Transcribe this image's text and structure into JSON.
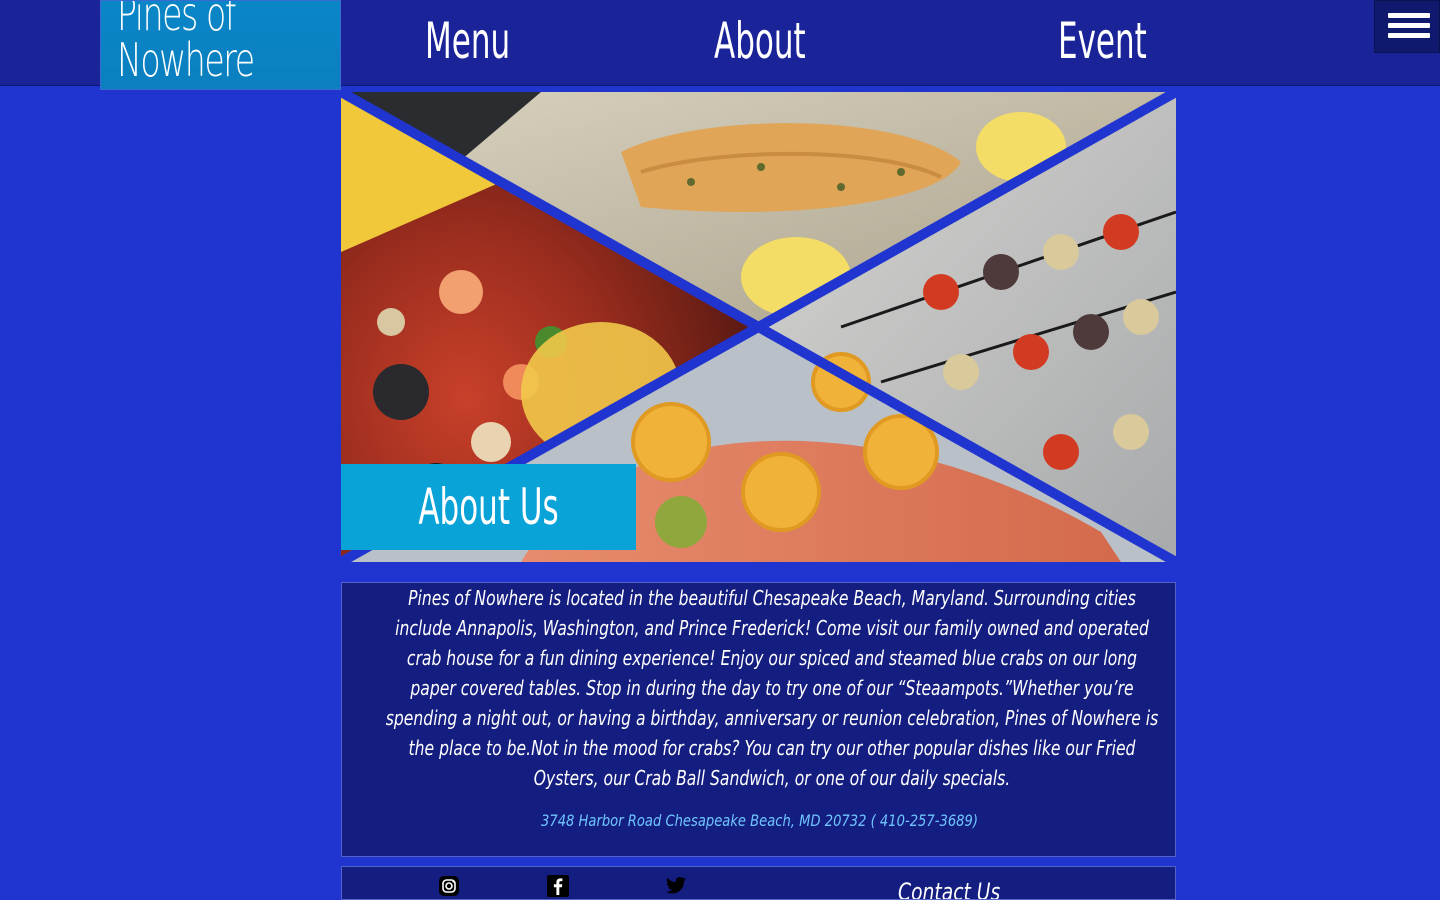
{
  "brand": {
    "name_line1": "Pines of",
    "name_line2": "Nowhere"
  },
  "nav": {
    "items": [
      {
        "label": "Menu"
      },
      {
        "label": "About"
      },
      {
        "label": "Event"
      }
    ],
    "menu_icon": "hamburger-icon"
  },
  "hero": {
    "badge": "About Us",
    "images": [
      "seafood-stew",
      "fish-fillet-lemon",
      "vegetable-skewers",
      "salmon-citrus"
    ]
  },
  "about": {
    "paragraph": "Pines of Nowhere is located in the beautiful Chesapeake Beach, Maryland. Surrounding cities include Annapolis, Washington, and Prince Frederick! Come visit our family owned and operated crab house for a fun dining experience! Enjoy our spiced and steamed blue crabs on our long paper covered tables. Stop in during the day to try one of our “Steaampots.”Whether you’re spending a night out, or having a birthday, anniversary or reunion celebration, Pines of Nowhere is the place to be.Not in the mood for crabs? You can try our other popular dishes like our Fried Oysters, our Crab Ball Sandwich, or one of our daily specials.",
    "address": "3748 Harbor Road Chesapeake Beach, MD 20732 ( 410-257-3689)"
  },
  "footer": {
    "social": [
      "instagram-icon",
      "facebook-icon",
      "twitter-icon"
    ],
    "contact": "Contact Us"
  },
  "colors": {
    "background": "#2035d0",
    "nav": "#1a2398",
    "logo": "#0a86c6",
    "badge": "#0aa3d8",
    "panel": "#141d80",
    "address": "#6fc6ff"
  }
}
